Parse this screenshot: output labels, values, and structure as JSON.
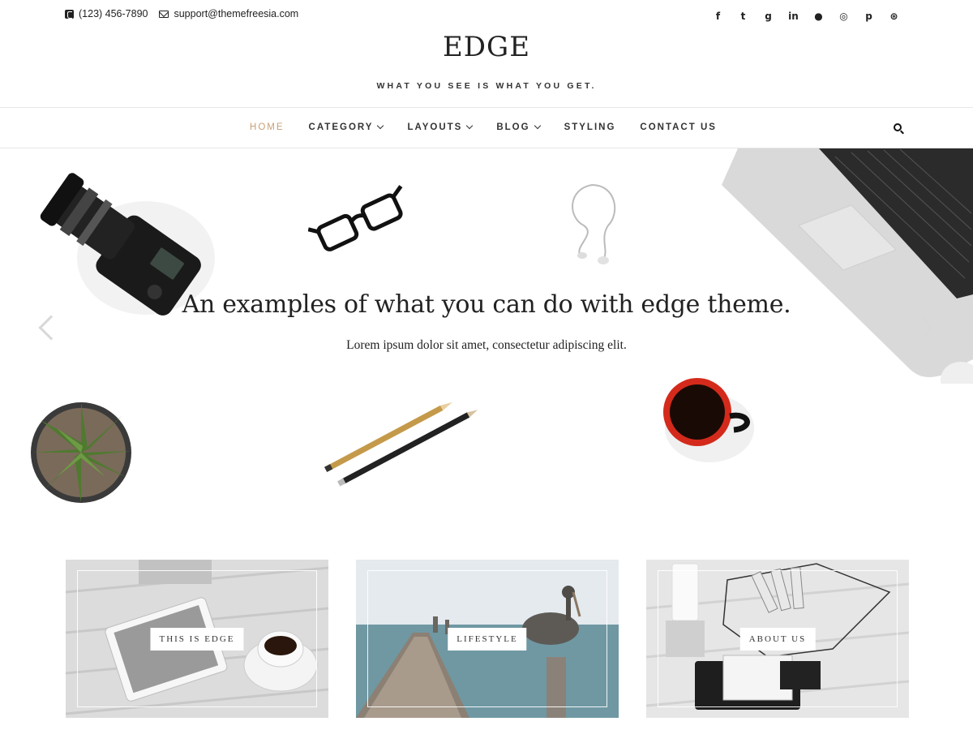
{
  "topbar": {
    "phone": "(123) 456-7890",
    "email": "support@themefreesia.com",
    "social": [
      {
        "icon": "facebook-icon",
        "glyph": "f"
      },
      {
        "icon": "twitter-icon",
        "glyph": "t"
      },
      {
        "icon": "google-plus-icon",
        "glyph": "g"
      },
      {
        "icon": "linkedin-icon",
        "glyph": "in"
      },
      {
        "icon": "flickr-icon",
        "glyph": "●"
      },
      {
        "icon": "instagram-icon",
        "glyph": "◎"
      },
      {
        "icon": "pinterest-icon",
        "glyph": "p"
      },
      {
        "icon": "dribbble-icon",
        "glyph": "⊛"
      }
    ]
  },
  "brand": {
    "title": "EDGE",
    "tagline": "WHAT YOU SEE IS WHAT YOU GET."
  },
  "nav": {
    "items": [
      {
        "label": "HOME",
        "active": true,
        "dropdown": false
      },
      {
        "label": "CATEGORY",
        "active": false,
        "dropdown": true
      },
      {
        "label": "LAYOUTS",
        "active": false,
        "dropdown": true
      },
      {
        "label": "BLOG",
        "active": false,
        "dropdown": true
      },
      {
        "label": "STYLING",
        "active": false,
        "dropdown": false
      },
      {
        "label": "CONTACT US",
        "active": false,
        "dropdown": false
      }
    ],
    "active_color": "#c89f76"
  },
  "slider": {
    "title": "An examples of what you can do with edge theme.",
    "subtitle": "Lorem ipsum dolor sit amet, consectetur adipiscing elit."
  },
  "features": [
    {
      "label": "THIS IS EDGE"
    },
    {
      "label": "LIFESTYLE"
    },
    {
      "label": "ABOUT US"
    }
  ]
}
